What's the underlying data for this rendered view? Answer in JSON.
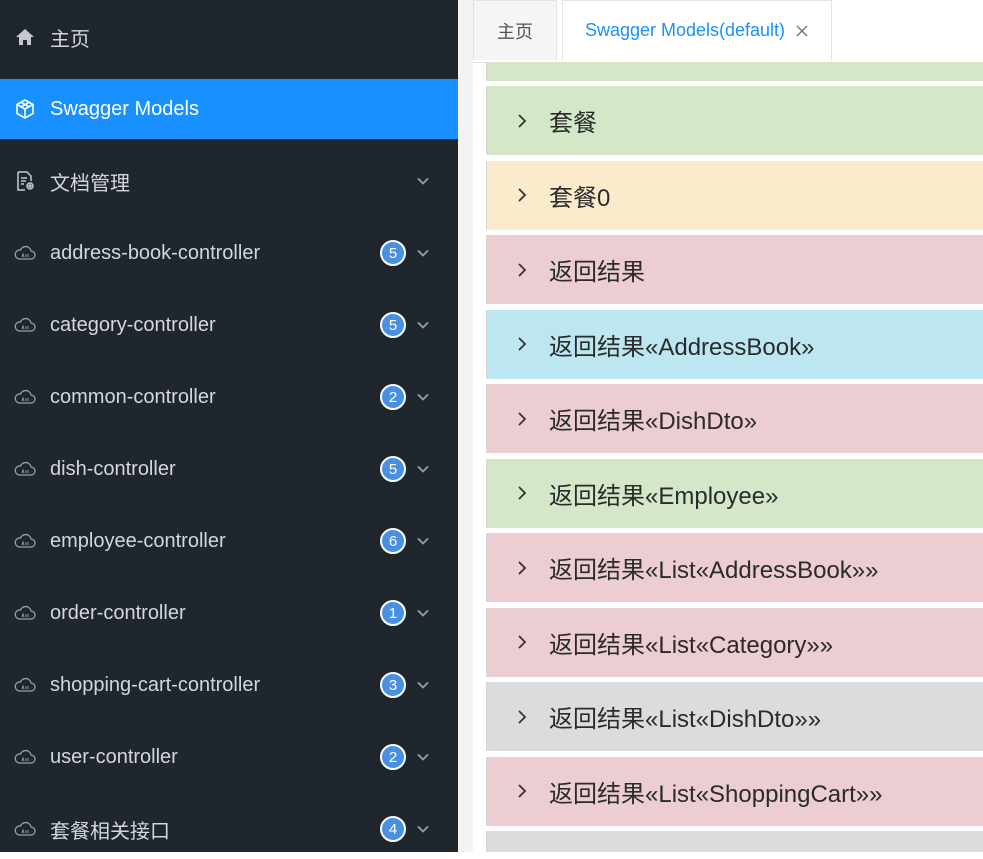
{
  "sidebar": {
    "home": {
      "label": "主页",
      "icon": "home-icon"
    },
    "swagger_models": {
      "label": "Swagger Models",
      "icon": "cube-icon"
    },
    "doc_management": {
      "label": "文档管理",
      "icon": "document-gear-icon"
    },
    "controllers": [
      {
        "label": "address-book-controller",
        "count": "5",
        "icon": "api-cloud-icon"
      },
      {
        "label": "category-controller",
        "count": "5",
        "icon": "api-cloud-icon"
      },
      {
        "label": "common-controller",
        "count": "2",
        "icon": "api-cloud-icon"
      },
      {
        "label": "dish-controller",
        "count": "5",
        "icon": "api-cloud-icon"
      },
      {
        "label": "employee-controller",
        "count": "6",
        "icon": "api-cloud-icon"
      },
      {
        "label": "order-controller",
        "count": "1",
        "icon": "api-cloud-icon"
      },
      {
        "label": "shopping-cart-controller",
        "count": "3",
        "icon": "api-cloud-icon"
      },
      {
        "label": "user-controller",
        "count": "2",
        "icon": "api-cloud-icon"
      },
      {
        "label": "套餐相关接口",
        "count": "4",
        "icon": "api-cloud-icon"
      }
    ]
  },
  "tabs": {
    "home_label": "主页",
    "models_label": "Swagger Models(default)",
    "close_label": "close"
  },
  "models": [
    {
      "label": "套餐",
      "color": "#d4e8c9"
    },
    {
      "label": "套餐0",
      "color": "#faebcd"
    },
    {
      "label": "返回结果",
      "color": "#ebcdd2"
    },
    {
      "label": "返回结果«AddressBook»",
      "color": "#bce6f0"
    },
    {
      "label": "返回结果«DishDto»",
      "color": "#ebcdd2"
    },
    {
      "label": "返回结果«Employee»",
      "color": "#d4e8c9"
    },
    {
      "label": "返回结果«List«AddressBook»»",
      "color": "#ebcdd2"
    },
    {
      "label": "返回结果«List«Category»»",
      "color": "#ebcdd2"
    },
    {
      "label": "返回结果«List«DishDto»»",
      "color": "#dcdcdc"
    },
    {
      "label": "返回结果«List«ShoppingCart»»",
      "color": "#ebcdd2"
    }
  ],
  "colors": {
    "sidebar_bg": "#1f262d",
    "active_bg": "#1890ff",
    "badge_bg": "#4a90e2",
    "tab_active_text": "#1890ff",
    "top_partial_row": "#d4e8c9",
    "bottom_partial_row": "#dcdcdc"
  }
}
